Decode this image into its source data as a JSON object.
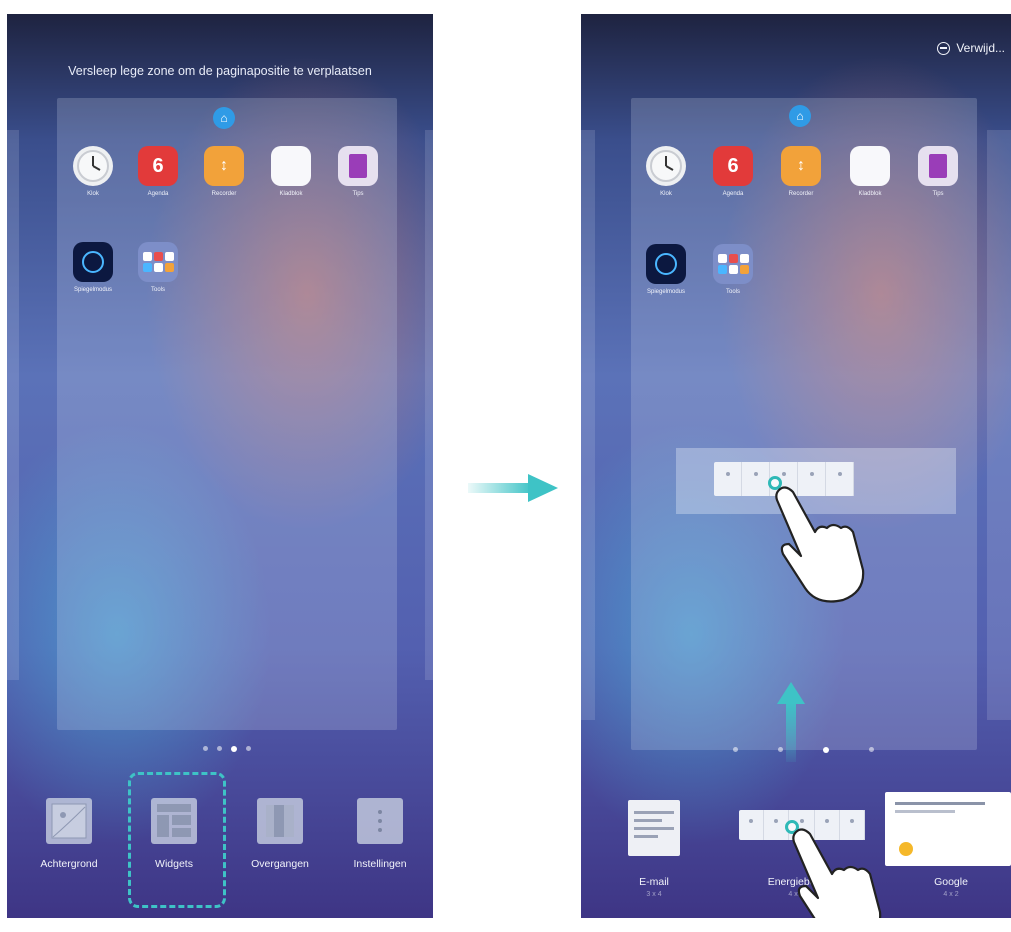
{
  "left_screen": {
    "page_hint": "Versleep lege zone om de paginapositie te verplaatsen",
    "apps_row1": [
      {
        "label": "Klok",
        "icon": "clock-icon"
      },
      {
        "label": "Agenda",
        "icon": "calendar-icon",
        "glyph": "6"
      },
      {
        "label": "Recorder",
        "icon": "recorder-icon",
        "glyph": "↕"
      },
      {
        "label": "Kladblok",
        "icon": "notepad-icon"
      },
      {
        "label": "Tips",
        "icon": "tips-icon"
      }
    ],
    "apps_row2": [
      {
        "label": "Spiegelmodus",
        "icon": "mirror-icon"
      },
      {
        "label": "Tools",
        "icon": "tools-folder-icon"
      }
    ],
    "options": [
      {
        "label": "Achtergrond",
        "icon": "wallpaper-icon"
      },
      {
        "label": "Widgets",
        "icon": "widgets-icon"
      },
      {
        "label": "Overgangen",
        "icon": "transitions-icon"
      },
      {
        "label": "Instellingen",
        "icon": "settings-icon"
      }
    ]
  },
  "right_screen": {
    "remove_label": "Verwijd...",
    "apps_row1": [
      {
        "label": "Klok",
        "icon": "clock-icon"
      },
      {
        "label": "Agenda",
        "icon": "calendar-icon",
        "glyph": "6"
      },
      {
        "label": "Recorder",
        "icon": "recorder-icon",
        "glyph": "↕"
      },
      {
        "label": "Kladblok",
        "icon": "notepad-icon"
      },
      {
        "label": "Tips",
        "icon": "tips-icon"
      }
    ],
    "apps_row2": [
      {
        "label": "Spiegelmodus",
        "icon": "mirror-icon"
      },
      {
        "label": "Tools",
        "icon": "tools-folder-icon"
      }
    ],
    "widget_picker": [
      {
        "label": "E-mail",
        "sub": "3 x 4"
      },
      {
        "label": "Energiebe...",
        "sub": "4 x 1"
      },
      {
        "label": "Google",
        "sub": "4 x 2"
      }
    ]
  },
  "colors": {
    "accent": "#3ec3c6",
    "home_icon": "#2f9be6"
  }
}
